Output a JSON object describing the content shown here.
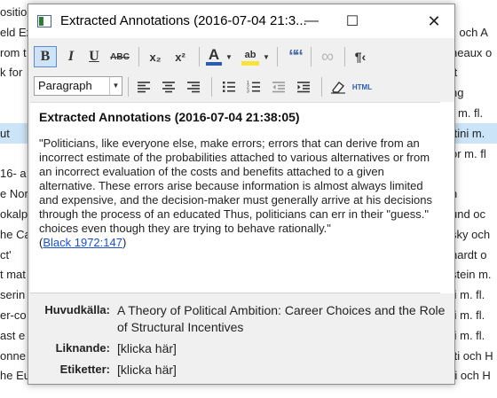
{
  "background": {
    "rows": [
      {
        "left": "ositio",
        "right": "",
        "selected": false
      },
      {
        "left": "eld Ex",
        "right": "ll och A",
        "selected": false
      },
      {
        "left": "rom t",
        "right": "neaux o",
        "selected": false
      },
      {
        "left": "k for",
        "right": "tt",
        "selected": false
      },
      {
        "left": "",
        "right": "ng",
        "selected": false
      },
      {
        "left": "",
        "right": "r m. fl.",
        "selected": false
      },
      {
        "left": "ut",
        "right": "ttini m.",
        "selected": true
      },
      {
        "left": "",
        "right": "or m. fl",
        "selected": false
      },
      {
        "left": " 16- a",
        "right": "",
        "selected": false
      },
      {
        "left": "e Nor",
        "right": "n",
        "selected": false
      },
      {
        "left": "okalp",
        "right": "und oc",
        "selected": false
      },
      {
        "left": "he Ca",
        "right": "sky och",
        "selected": false
      },
      {
        "left": "ct'",
        "right": "hardt o",
        "selected": false
      },
      {
        "left": "t mat",
        "right": "stein m.",
        "selected": false
      },
      {
        "left": "serin",
        "right": "ti m. fl.",
        "selected": false
      },
      {
        "left": "er-co",
        "right": "ti m. fl.",
        "selected": false
      },
      {
        "left": "ast e",
        "right": "ti m. fl.",
        "selected": false
      },
      {
        "left": "onne",
        "right": "tti och H",
        "selected": false
      },
      {
        "left": "he European Parliament – How turnout will continue to decline in the f...",
        "right": "Bhatti och H",
        "selected": false
      }
    ]
  },
  "window": {
    "title": "Extracted Annotations (2016-07-04 21:3...",
    "minimize": "—",
    "maximize": "☐",
    "close": "✕"
  },
  "toolbar": {
    "bold": "B",
    "italic": "I",
    "underline": "U",
    "strikethrough": "ABC",
    "subscript": "x₂",
    "superscript": "x²",
    "font_color": "A",
    "highlight": "ab",
    "blockquote": "““",
    "link": "∞",
    "pilcrow": "¶‹",
    "paragraph_select": "Paragraph",
    "html": "HTML",
    "accent_color": "#2a5db0",
    "highlight_color": "#f7e23e"
  },
  "editor": {
    "heading": "Extracted Annotations (2016-07-04 21:38:05)",
    "quote": "\"Politicians, like everyone else, make errors; errors that can derive from an incorrect estimate of the probabilities attached to various alternatives or from an incorrect evaluation of the costs and benefits attached to a given alternative. These errors arise because information is almost always limited and expensive, and the decision-maker must generally arrive at his decisions through the process of an educated Thus, politicians can err in their \"guess.\" choices even though they are trying to behave rationally.\"",
    "cite_open": "(",
    "cite_link": "Black 1972:147",
    "cite_close": ")"
  },
  "fields": {
    "source_label": "Huvudkälla:",
    "source_value": "A Theory of Political Ambition: Career Choices and the Role of Structural Incentives",
    "similar_label": "Liknande:",
    "similar_value": "[klicka här]",
    "tags_label": "Etiketter:",
    "tags_value": "[klicka här]"
  }
}
